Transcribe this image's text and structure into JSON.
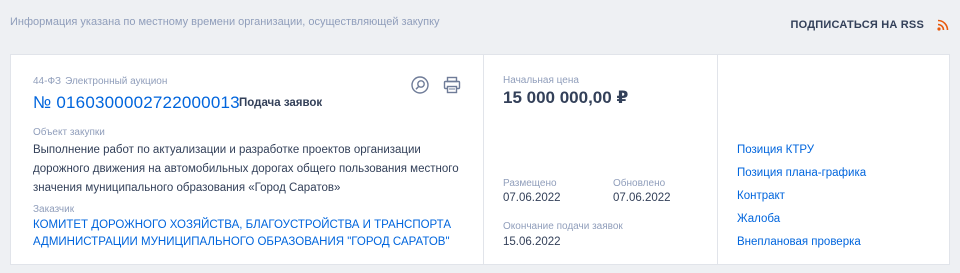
{
  "header": {
    "notice": "Информация указана по местному времени организации, осуществляющей закупку",
    "rss_label": "ПОДПИСАТЬСЯ НА RSS"
  },
  "purchase": {
    "law": "44-ФЗ",
    "type": "Электронный аукцион",
    "number": "№ 0160300002722000013",
    "stage": "Подача заявок",
    "object_label": "Объект закупки",
    "object_text": "Выполнение работ по актуализации и разработке проектов организации дорожного движения на автомобильных дорогах общего пользования местного значения муниципального образования «Город Саратов»",
    "customer_label": "Заказчик",
    "customer_name": "КОМИТЕТ ДОРОЖНОГО ХОЗЯЙСТВА, БЛАГОУСТРОЙСТВА И ТРАНСПОРТА АДМИНИСТРАЦИИ МУНИЦИПАЛЬНОГО ОБРАЗОВАНИЯ \"ГОРОД САРАТОВ\"",
    "price_label": "Начальная цена",
    "price_value": "15 000 000,00 ₽",
    "posted_label": "Размещено",
    "posted_value": "07.06.2022",
    "updated_label": "Обновлено",
    "updated_value": "07.06.2022",
    "deadline_label": "Окончание подачи заявок",
    "deadline_value": "15.06.2022"
  },
  "links": [
    {
      "label": "Позиция КТРУ"
    },
    {
      "label": "Позиция плана-графика"
    },
    {
      "label": "Контракт"
    },
    {
      "label": "Жалоба"
    },
    {
      "label": "Внеплановая проверка"
    }
  ],
  "icons": {
    "view": "magnifier-icon",
    "print": "printer-icon",
    "rss": "rss-icon"
  },
  "colors": {
    "accent": "#0065dd",
    "text": "#334059",
    "muted": "#909ebb",
    "rss": "#e8590c"
  }
}
